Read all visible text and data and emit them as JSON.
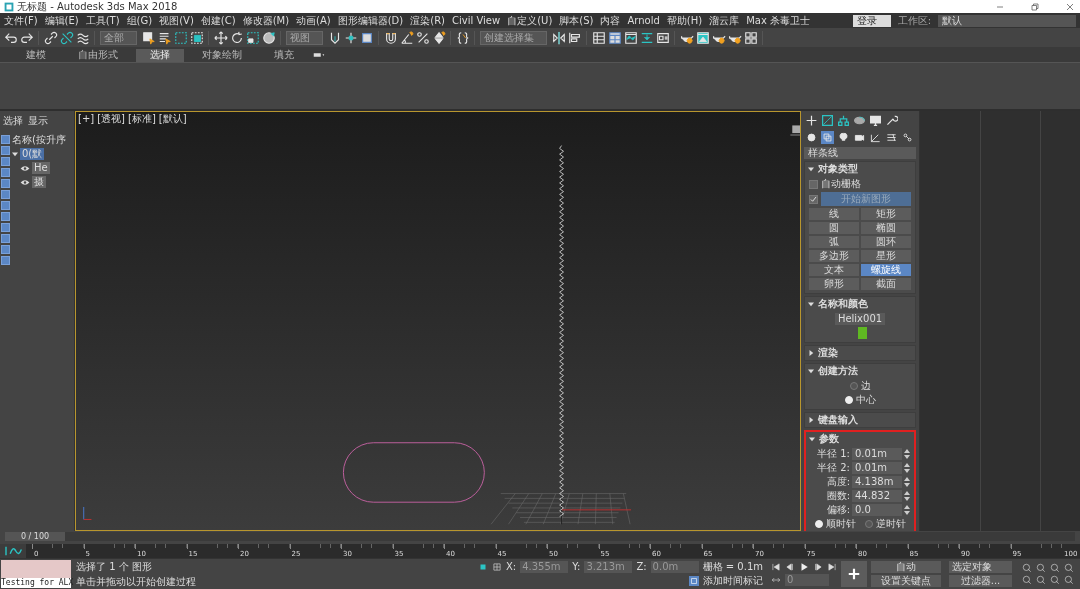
{
  "window": {
    "title": "无标题 - Autodesk 3ds Max 2018"
  },
  "menu": [
    "文件(F)",
    "编辑(E)",
    "工具(T)",
    "组(G)",
    "视图(V)",
    "创建(C)",
    "修改器(M)",
    "动画(A)",
    "图形编辑器(D)",
    "渲染(R)",
    "Civil View",
    "自定义(U)",
    "脚本(S)",
    "内容",
    "Arnold",
    "帮助(H)",
    "溜云库",
    "Max 杀毒卫士"
  ],
  "account": "登录",
  "workspace": {
    "label": "工作区:",
    "value": "默认"
  },
  "toolbar": {
    "selection_filter": "全部",
    "reference_coordinate_system": "视图",
    "named_selection_set": "创建选择集"
  },
  "ribbon_tabs": [
    {
      "label": "建模",
      "selected": false
    },
    {
      "label": "自由形式",
      "selected": false
    },
    {
      "label": "选择",
      "selected": true
    },
    {
      "label": "对象绘制",
      "selected": false
    },
    {
      "label": "填充",
      "selected": false
    }
  ],
  "scene_explorer": {
    "tabs": [
      "选择",
      "显示"
    ],
    "column_header": "名称(按升序",
    "items": [
      {
        "name": "0(默",
        "selected": true,
        "expanded": true,
        "children": [
          {
            "name": "He",
            "selected": false
          },
          {
            "name": "摄",
            "selected": false
          }
        ]
      }
    ]
  },
  "viewport": {
    "labels": [
      "[+]",
      "[透视]",
      "[标准]",
      "[默认]"
    ],
    "active": true
  },
  "command_panel": {
    "object_categories": [
      {
        "selected": false
      },
      {
        "selected": true
      },
      {
        "selected": false
      },
      {
        "selected": false
      },
      {
        "selected": false
      },
      {
        "selected": false
      },
      {
        "selected": false
      }
    ],
    "category": "样条线",
    "rollouts": [
      {
        "kind": "object_type",
        "title": "对象类型",
        "expanded": true,
        "autogrid": {
          "label": "自动栅格",
          "checked": false
        },
        "start_new_shape": {
          "label": "开始新图形",
          "checked": true
        },
        "buttons": [
          {
            "label": "线",
            "selected": false
          },
          {
            "label": "矩形",
            "selected": false
          },
          {
            "label": "圆",
            "selected": false
          },
          {
            "label": "椭圆",
            "selected": false
          },
          {
            "label": "弧",
            "selected": false
          },
          {
            "label": "圆环",
            "selected": false
          },
          {
            "label": "多边形",
            "selected": false
          },
          {
            "label": "星形",
            "selected": false
          },
          {
            "label": "文本",
            "selected": false
          },
          {
            "label": "螺旋线",
            "selected": true
          },
          {
            "label": "卵形",
            "selected": false
          },
          {
            "label": "截面",
            "selected": false
          }
        ]
      },
      {
        "kind": "name_color",
        "title": "名称和颜色",
        "expanded": true,
        "name": "Helix001",
        "color": "#5fb822"
      },
      {
        "title": "渲染",
        "expanded": false
      },
      {
        "kind": "creation_method",
        "title": "创建方法",
        "expanded": true,
        "options": [
          {
            "label": "边",
            "selected": false
          },
          {
            "label": "中心",
            "selected": true
          }
        ]
      },
      {
        "title": "键盘输入",
        "expanded": false
      },
      {
        "kind": "parameters",
        "title": "参数",
        "expanded": true,
        "highlighted": true,
        "fields": [
          {
            "label": "半径 1:",
            "value": "0.01m"
          },
          {
            "label": "半径 2:",
            "value": "0.01m"
          },
          {
            "label": "高度:",
            "value": "4.138m"
          },
          {
            "label": "圈数:",
            "value": "44.832"
          },
          {
            "label": "偏移:",
            "value": "0.0"
          }
        ],
        "options": [
          {
            "label": "顺时针",
            "selected": true
          },
          {
            "label": "逆时针",
            "selected": false
          }
        ]
      }
    ]
  },
  "timeline": {
    "frame": "0 / 100",
    "level": 0,
    "ticks": [
      "0",
      "5",
      "10",
      "15",
      "20",
      "25",
      "30",
      "35",
      "40",
      "45",
      "50",
      "55",
      "60",
      "65",
      "70",
      "75",
      "80",
      "85",
      "90",
      "95",
      "100"
    ]
  },
  "status": {
    "listener": "Testing for ALX",
    "messages": [
      "选择了 1 个 图形",
      "单击并拖动以开始创建过程"
    ],
    "coords": [
      {
        "axis": "X:",
        "value": "4.355m"
      },
      {
        "axis": "Y:",
        "value": "3.213m"
      },
      {
        "axis": "Z:",
        "value": "0.0m"
      }
    ],
    "grid": "栅格 = 0.1m",
    "time_tag": "添加时间标记",
    "frame": "0",
    "auto_key": "自动",
    "key_target": "选定对象",
    "set_key": "设置关键点",
    "filters": "过滤器..."
  }
}
